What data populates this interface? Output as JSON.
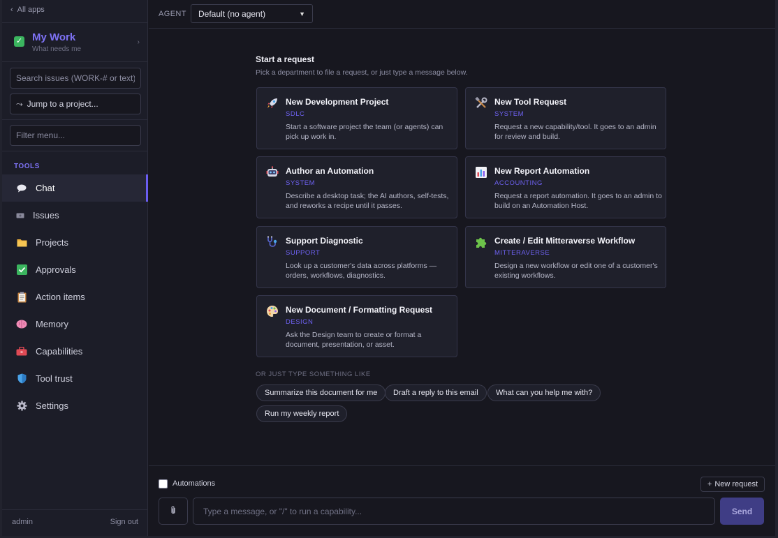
{
  "sidebar": {
    "all_apps": "All apps",
    "mywork_title": "My Work",
    "mywork_sub": "What needs me",
    "search_placeholder": "Search issues (WORK-# or text)...",
    "jump_label": "Jump to a project...",
    "filter_placeholder": "Filter menu...",
    "tools_label": "TOOLS",
    "items": [
      {
        "label": "Chat",
        "icon": "speech-bubble-icon"
      },
      {
        "label": "Issues",
        "icon": "ticket-icon"
      },
      {
        "label": "Projects",
        "icon": "folder-icon"
      },
      {
        "label": "Approvals",
        "icon": "check-box-icon"
      },
      {
        "label": "Action items",
        "icon": "clipboard-icon"
      },
      {
        "label": "Memory",
        "icon": "brain-icon"
      },
      {
        "label": "Capabilities",
        "icon": "toolbox-icon"
      },
      {
        "label": "Tool trust",
        "icon": "shield-icon"
      },
      {
        "label": "Settings",
        "icon": "gear-icon"
      }
    ],
    "admin": "admin",
    "sign_out": "Sign out"
  },
  "topbar": {
    "agent_label": "AGENT",
    "agent_value": "Default (no agent)"
  },
  "main": {
    "heading": "Start a request",
    "subheading": "Pick a department to file a request, or just type a message below.",
    "cards": [
      {
        "title": "New Development Project",
        "dept": "SDLC",
        "desc": "Start a software project the team (or agents) can pick up work in.",
        "icon": "rocket-icon"
      },
      {
        "title": "New Tool Request",
        "dept": "SYSTEM",
        "desc": "Request a new capability/tool. It goes to an admin for review and build.",
        "icon": "tools-icon"
      },
      {
        "title": "Author an Automation",
        "dept": "SYSTEM",
        "desc": "Describe a desktop task; the AI authors, self-tests, and reworks a recipe until it passes.",
        "icon": "robot-icon"
      },
      {
        "title": "New Report Automation",
        "dept": "ACCOUNTING",
        "desc": "Request a report automation. It goes to an admin to build on an Automation Host.",
        "icon": "bar-chart-icon"
      },
      {
        "title": "Support Diagnostic",
        "dept": "SUPPORT",
        "desc": "Look up a customer's data across platforms — orders, workflows, diagnostics.",
        "icon": "stethoscope-icon"
      },
      {
        "title": "Create / Edit Mitteraverse Workflow",
        "dept": "MITTERAVERSE",
        "desc": "Design a new workflow or edit one of a customer's existing workflows.",
        "icon": "puzzle-icon"
      },
      {
        "title": "New Document / Formatting Request",
        "dept": "DESIGN",
        "desc": "Ask the Design team to create or format a document, presentation, or asset.",
        "icon": "palette-icon"
      }
    ],
    "or_label": "OR JUST TYPE SOMETHING LIKE",
    "suggestions": [
      "Summarize this document for me",
      "Draft a reply to this email",
      "What can you help me with?",
      "Run my weekly report"
    ]
  },
  "composer": {
    "automations_label": "Automations",
    "new_request": "New request",
    "message_placeholder": "Type a message, or \"/\" to run a capability...",
    "send_label": "Send"
  }
}
